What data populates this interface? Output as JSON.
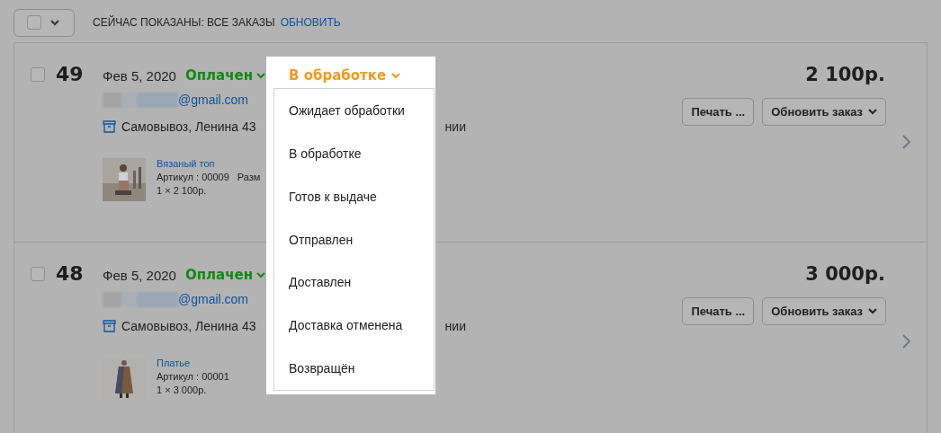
{
  "toolbar": {
    "select_all": {
      "checked": false
    },
    "label": "СЕЙЧАС ПОКАЗАНЫ: ВСЕ ЗАКАЗЫ",
    "link": "ОБНОВИТЬ"
  },
  "orders": [
    {
      "checked": false,
      "number": "49",
      "date": "Фев 5, 2020",
      "payment": "Оплачен",
      "fulfilment": "В обработке",
      "email": "@gmail.com",
      "delivery": "Самовывоз, Ленина 43",
      "delivery_tail": "нии",
      "item": {
        "name": "Вязаный топ",
        "sku": "Артикул : 00009",
        "size": "Разм",
        "qty": "1 × 2 100р."
      },
      "total": "2 100р.",
      "buttons": [
        "Печать ...",
        "Обновить заказ"
      ]
    },
    {
      "checked": false,
      "number": "48",
      "date": "Фев 5, 2020",
      "payment": "Оплачен",
      "email": "@gmail.com",
      "delivery": "Самовывоз, Ленина 43",
      "delivery_tail": "нии",
      "item": {
        "name": "Платье",
        "sku": "Артикул : 00001",
        "qty": "1 × 3 000р."
      },
      "total": "3 000р.",
      "buttons": [
        "Печать ...",
        "Обновить заказ"
      ]
    }
  ],
  "status_menu": {
    "items": [
      "Ожидает обработки",
      "В обработке",
      "Готов к выдаче",
      "Отправлен",
      "Доставлен",
      "Доставка отменена",
      "Возвращён"
    ]
  }
}
